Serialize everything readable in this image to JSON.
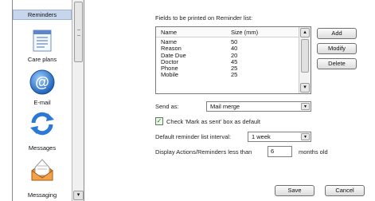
{
  "nav": {
    "items": [
      {
        "label": "Reminders",
        "icon": "reminders-icon",
        "selected": true
      },
      {
        "label": "Care plans",
        "icon": "care-plans-icon"
      },
      {
        "label": "E-mail",
        "icon": "email-icon"
      },
      {
        "label": "Messages",
        "icon": "messages-icon"
      },
      {
        "label": "Messaging",
        "icon": "messaging-icon"
      }
    ],
    "scroll_down": "▾"
  },
  "fields": {
    "caption": "Fields to be printed on Reminder list:",
    "col_name": "Name",
    "col_size": "Size (mm)",
    "rows": [
      {
        "name": "Name",
        "size": "50"
      },
      {
        "name": "Reason",
        "size": "40"
      },
      {
        "name": "Date Due",
        "size": "20"
      },
      {
        "name": "Doctor",
        "size": "45"
      },
      {
        "name": "Phone",
        "size": "25"
      },
      {
        "name": "Mobile",
        "size": "25"
      }
    ],
    "up_arrow": "▴",
    "down_arrow": "▾"
  },
  "buttons": {
    "add": "Add",
    "modify": "Modify",
    "delete": "Delete",
    "save": "Save",
    "cancel": "Cancel"
  },
  "send_as": {
    "label": "Send as:",
    "value": "Mail merge"
  },
  "mark_as_sent": {
    "label": "Check 'Mark as sent' box as default",
    "checked": true
  },
  "interval": {
    "label": "Default reminder list interval:",
    "value": "1 week"
  },
  "display": {
    "label": "Display Actions/Reminders less than",
    "value": "6",
    "suffix": "months old"
  },
  "combo_arrow": "▾"
}
